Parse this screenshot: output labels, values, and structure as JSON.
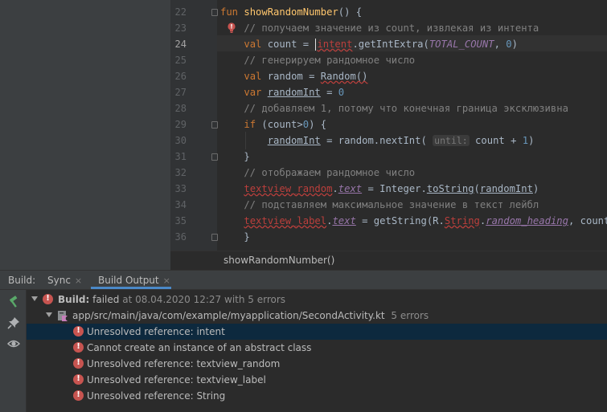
{
  "editor": {
    "current_line": "24",
    "lines": [
      {
        "n": "22",
        "segments": [
          {
            "t": "fun ",
            "c": "kw"
          },
          {
            "t": "showRandomNumber",
            "c": "fn"
          },
          {
            "t": "() {",
            "c": ""
          }
        ]
      },
      {
        "n": "23",
        "segments": [
          {
            "t": "    // получаем значение из count, извлекая из интента",
            "c": "cm"
          }
        ]
      },
      {
        "n": "24",
        "segments": [
          {
            "t": "    ",
            "c": ""
          },
          {
            "t": "val ",
            "c": "kw"
          },
          {
            "t": "count = ",
            "c": ""
          },
          {
            "t": "CARET",
            "c": "caret"
          },
          {
            "t": "intent",
            "c": "err"
          },
          {
            "t": ".getIntExtra(",
            "c": ""
          },
          {
            "t": "TOTAL_COUNT",
            "c": "const"
          },
          {
            "t": ", ",
            "c": ""
          },
          {
            "t": "0",
            "c": "num"
          },
          {
            "t": ")",
            "c": ""
          }
        ]
      },
      {
        "n": "25",
        "segments": [
          {
            "t": "    // генерируем рандомное число",
            "c": "cm"
          }
        ]
      },
      {
        "n": "26",
        "segments": [
          {
            "t": "    ",
            "c": ""
          },
          {
            "t": "val ",
            "c": "kw"
          },
          {
            "t": "random = ",
            "c": ""
          },
          {
            "t": "Random()",
            "c": "warn"
          }
        ]
      },
      {
        "n": "27",
        "segments": [
          {
            "t": "    ",
            "c": ""
          },
          {
            "t": "var ",
            "c": "kw"
          },
          {
            "t": "randomInt",
            "c": "ul"
          },
          {
            "t": " = ",
            "c": ""
          },
          {
            "t": "0",
            "c": "num"
          }
        ]
      },
      {
        "n": "28",
        "segments": [
          {
            "t": "    // добавляем 1, потому что конечная граница эксклюзивна",
            "c": "cm"
          }
        ]
      },
      {
        "n": "29",
        "segments": [
          {
            "t": "    ",
            "c": ""
          },
          {
            "t": "if ",
            "c": "kw"
          },
          {
            "t": "(count>",
            "c": ""
          },
          {
            "t": "0",
            "c": "num"
          },
          {
            "t": ") {",
            "c": ""
          }
        ]
      },
      {
        "n": "30",
        "segments": [
          {
            "t": "        ",
            "c": ""
          },
          {
            "t": "randomInt",
            "c": "ul"
          },
          {
            "t": " = random.nextInt( ",
            "c": ""
          },
          {
            "t": "until:",
            "c": "hint"
          },
          {
            "t": " count + ",
            "c": ""
          },
          {
            "t": "1",
            "c": "num"
          },
          {
            "t": ")",
            "c": ""
          }
        ]
      },
      {
        "n": "31",
        "segments": [
          {
            "t": "    }",
            "c": ""
          }
        ]
      },
      {
        "n": "32",
        "segments": [
          {
            "t": "    // отображаем рандомное число",
            "c": "cm"
          }
        ]
      },
      {
        "n": "33",
        "segments": [
          {
            "t": "    ",
            "c": ""
          },
          {
            "t": "textview_random",
            "c": "err"
          },
          {
            "t": ".",
            "c": ""
          },
          {
            "t": "text",
            "c": "prop-u"
          },
          {
            "t": " = Integer.",
            "c": ""
          },
          {
            "t": "toString",
            "c": "ul"
          },
          {
            "t": "(",
            "c": ""
          },
          {
            "t": "randomInt",
            "c": "ul"
          },
          {
            "t": ")",
            "c": ""
          }
        ]
      },
      {
        "n": "34",
        "segments": [
          {
            "t": "    // подставляем максимальное значение в текст лейбл",
            "c": "cm"
          }
        ]
      },
      {
        "n": "35",
        "segments": [
          {
            "t": "    ",
            "c": ""
          },
          {
            "t": "textview_label",
            "c": "err"
          },
          {
            "t": ".",
            "c": ""
          },
          {
            "t": "text",
            "c": "prop-u"
          },
          {
            "t": " = getString(R.",
            "c": ""
          },
          {
            "t": "String",
            "c": "err"
          },
          {
            "t": ".",
            "c": ""
          },
          {
            "t": "random_heading",
            "c": "prop-u"
          },
          {
            "t": ", count)",
            "c": ""
          }
        ]
      },
      {
        "n": "36",
        "segments": [
          {
            "t": "    }",
            "c": ""
          }
        ]
      }
    ]
  },
  "breadcrumb": "showRandomNumber()",
  "tool_window": {
    "label": "Build:",
    "tabs": [
      {
        "label": "Sync",
        "close": "×"
      },
      {
        "label": "Build Output",
        "close": "×"
      }
    ],
    "side_icons": [
      "hammer-icon",
      "pin-icon",
      "eye-icon"
    ]
  },
  "build": {
    "status_label": "Build:",
    "status_value": "failed",
    "status_detail": "at 08.04.2020 12:27 with 5 errors",
    "file_path": "app/src/main/java/com/example/myapplication/SecondActivity.kt",
    "file_errors": "5 errors",
    "errors": [
      "Unresolved reference: intent",
      "Cannot create an instance of an abstract class",
      "Unresolved reference: textview_random",
      "Unresolved reference: textview_label",
      "Unresolved reference: String"
    ]
  }
}
